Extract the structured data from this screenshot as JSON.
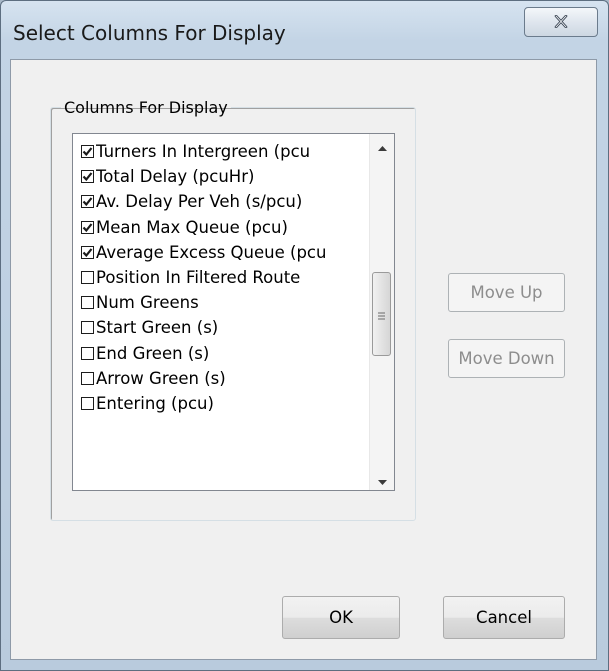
{
  "window": {
    "title": "Select Columns For Display"
  },
  "group": {
    "legend": "Columns For Display"
  },
  "list": {
    "items": [
      {
        "label": "Turners In Intergreen (pcu",
        "checked": true
      },
      {
        "label": "Total Delay (pcuHr)",
        "checked": true
      },
      {
        "label": "Av. Delay Per Veh (s/pcu)",
        "checked": true
      },
      {
        "label": "Mean Max Queue (pcu)",
        "checked": true
      },
      {
        "label": "Average Excess Queue (pcu",
        "checked": true
      },
      {
        "label": "Position In Filtered Route",
        "checked": false
      },
      {
        "label": "Num Greens",
        "checked": false
      },
      {
        "label": "Start Green (s)",
        "checked": false
      },
      {
        "label": "End Green (s)",
        "checked": false
      },
      {
        "label": "Arrow Green (s)",
        "checked": false
      },
      {
        "label": "Entering (pcu)",
        "checked": false
      }
    ]
  },
  "buttons": {
    "move_up": "Move Up",
    "move_down": "Move Down",
    "ok": "OK",
    "cancel": "Cancel"
  }
}
